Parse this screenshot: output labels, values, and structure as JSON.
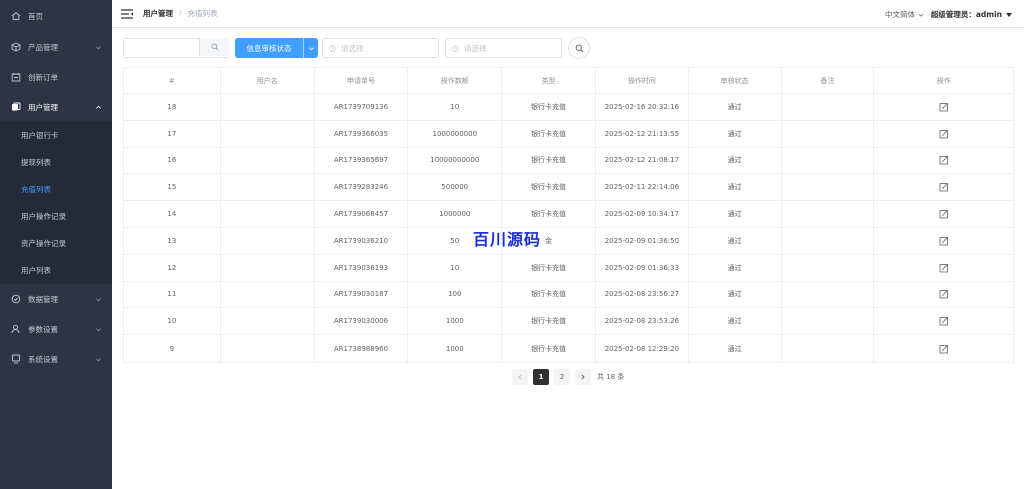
{
  "sidebar": {
    "items": [
      {
        "label": "首页",
        "icon": "home-icon"
      },
      {
        "label": "产品管理",
        "icon": "cube-icon"
      },
      {
        "label": "创新订单",
        "icon": "calendar-icon"
      },
      {
        "label": "用户管理",
        "icon": "users-icon"
      }
    ],
    "submenu": [
      "用户银行卡",
      "提现列表",
      "充值列表",
      "用户操作记录",
      "资产操作记录",
      "用户列表"
    ],
    "active_sub": "充值列表",
    "bottom_items": [
      {
        "label": "数据管理",
        "icon": "check-circle-icon"
      },
      {
        "label": "参数设置",
        "icon": "user-gear-icon"
      },
      {
        "label": "系统设置",
        "icon": "monitor-icon"
      }
    ]
  },
  "header": {
    "breadcrumb_parent": "用户管理",
    "breadcrumb_current": "充值列表",
    "language": "中文简体",
    "user": "超级管理员：admin"
  },
  "filters": {
    "search_value": "",
    "status_button": "信息审核状态",
    "start_placeholder": "请选择",
    "end_placeholder": "请选择"
  },
  "table": {
    "headers": [
      "#",
      "用户名",
      "申请单号",
      "操作数额",
      "类型",
      "操作时间",
      "审核状态",
      "备注",
      "操作"
    ],
    "rows": [
      {
        "id": "18",
        "user": "",
        "order": "AR1739709136",
        "amount": "10",
        "type": "银行卡充值",
        "time": "2025-02-16 20:32:16",
        "status": "通过",
        "note": ""
      },
      {
        "id": "17",
        "user": "",
        "order": "AR1739366035",
        "amount": "1000000000",
        "type": "银行卡充值",
        "time": "2025-02-12 21:13:55",
        "status": "通过",
        "note": ""
      },
      {
        "id": "16",
        "user": "",
        "order": "AR1739365697",
        "amount": "10000000000",
        "type": "银行卡充值",
        "time": "2025-02-12 21:08:17",
        "status": "通过",
        "note": ""
      },
      {
        "id": "15",
        "user": "",
        "order": "AR1739283246",
        "amount": "500000",
        "type": "银行卡充值",
        "time": "2025-02-11 22:14:06",
        "status": "通过",
        "note": ""
      },
      {
        "id": "14",
        "user": "",
        "order": "AR1739068457",
        "amount": "1000000",
        "type": "银行卡充值",
        "time": "2025-02-09 10:34:17",
        "status": "通过",
        "note": ""
      },
      {
        "id": "13",
        "user": "",
        "order": "AR1739036210",
        "amount": "50",
        "type": "金",
        "time": "2025-02-09 01:36:50",
        "status": "通过",
        "note": ""
      },
      {
        "id": "12",
        "user": "",
        "order": "AR1739036193",
        "amount": "10",
        "type": "银行卡充值",
        "time": "2025-02-09 01:36:33",
        "status": "通过",
        "note": ""
      },
      {
        "id": "11",
        "user": "",
        "order": "AR1739030187",
        "amount": "100",
        "type": "银行卡充值",
        "time": "2025-02-08 23:56:27",
        "status": "通过",
        "note": ""
      },
      {
        "id": "10",
        "user": "",
        "order": "AR1739030006",
        "amount": "1000",
        "type": "银行卡充值",
        "time": "2025-02-08 23:53:26",
        "status": "通过",
        "note": ""
      },
      {
        "id": "9",
        "user": "",
        "order": "AR1738988960",
        "amount": "1000",
        "type": "银行卡充值",
        "time": "2025-02-08 12:29:20",
        "status": "通过",
        "note": ""
      }
    ]
  },
  "watermark": "百川源码",
  "pagination": {
    "pages": [
      "1",
      "2"
    ],
    "current": "1",
    "total": "共 18 条"
  },
  "colors": {
    "sidebar_bg": "#2e3443",
    "submenu_bg": "#242a37",
    "accent": "#409eff",
    "watermark": "#1b2fd6"
  }
}
